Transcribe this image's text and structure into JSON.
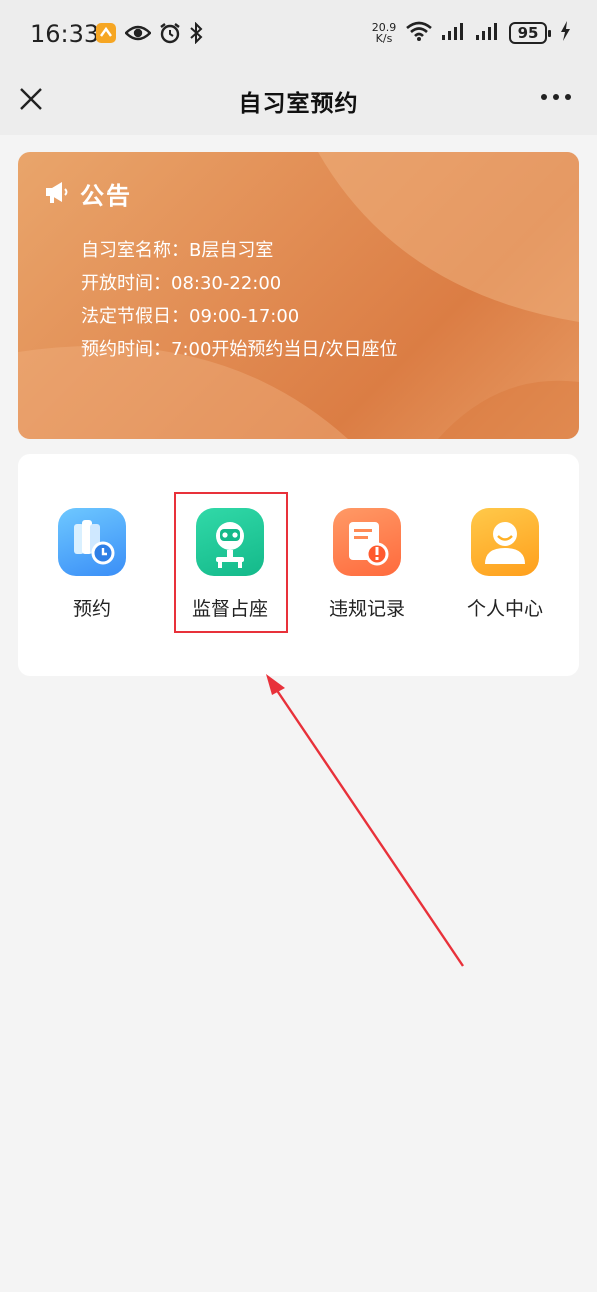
{
  "status_bar": {
    "time": "16:33",
    "net_speed_value": "20.9",
    "net_speed_unit": "K/s",
    "battery": "95",
    "icons": [
      "app-badge-icon",
      "eye-icon",
      "alarm-icon",
      "bluetooth-icon",
      "wifi-icon",
      "signal-icon",
      "signal-icon",
      "battery-icon",
      "charging-icon"
    ]
  },
  "nav": {
    "title": "自习室预约",
    "close_icon": "close-icon",
    "more_icon": "more-icon"
  },
  "notice": {
    "title": "公告",
    "icon": "megaphone-icon",
    "lines": [
      "自习室名称：B层自习室",
      "开放时间：08:30-22:00",
      "法定节假日：09:00-17:00",
      "预约时间：7:00开始预约当日/次日座位"
    ]
  },
  "menu": {
    "items": [
      {
        "label": "预约",
        "icon": "book-clock-icon"
      },
      {
        "label": "监督占座",
        "icon": "seat-monitor-icon"
      },
      {
        "label": "违规记录",
        "icon": "violation-record-icon"
      },
      {
        "label": "个人中心",
        "icon": "person-icon"
      }
    ]
  },
  "colors": {
    "notice_bg": "#e28e55",
    "highlight": "#e8313a",
    "page_bg": "#f4f4f4"
  }
}
